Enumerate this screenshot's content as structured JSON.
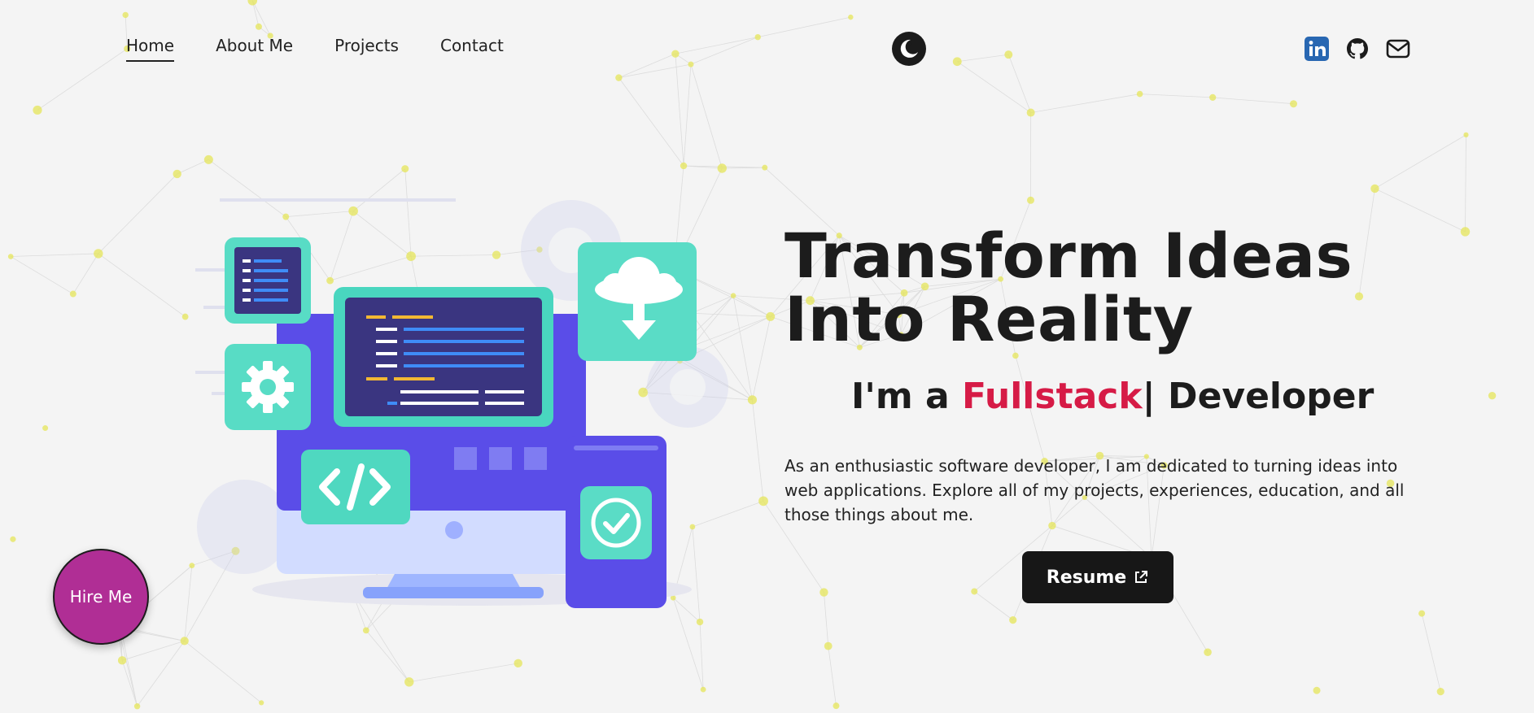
{
  "nav": {
    "items": [
      {
        "label": "Home",
        "active": true
      },
      {
        "label": "About Me",
        "active": false
      },
      {
        "label": "Projects",
        "active": false
      },
      {
        "label": "Contact",
        "active": false
      }
    ]
  },
  "theme_toggle": {
    "icon": "moon-icon"
  },
  "socials": [
    {
      "icon": "linkedin-icon",
      "color": "#2867b2"
    },
    {
      "icon": "github-icon",
      "color": "#1b1b1b"
    },
    {
      "icon": "mail-icon",
      "color": "#1b1b1b"
    }
  ],
  "hero": {
    "headline_line1": "Transform Ideas",
    "headline_line2": "Into Reality",
    "subline_prefix": "I'm a ",
    "subline_role": "Fullstack",
    "subline_suffix": "| Developer",
    "intro": "As an enthusiastic software developer, I am dedicated to turning ideas into web applications. Explore all of my projects, experiences, education, and all those things about me.",
    "resume_label": "Resume"
  },
  "hire_me": {
    "label": "Hire Me"
  },
  "colors": {
    "background": "#f4f4f4",
    "accent": "#d61b46",
    "hire_button": "#b02e95",
    "button_dark": "#171717",
    "particle": "#e6e65a"
  }
}
